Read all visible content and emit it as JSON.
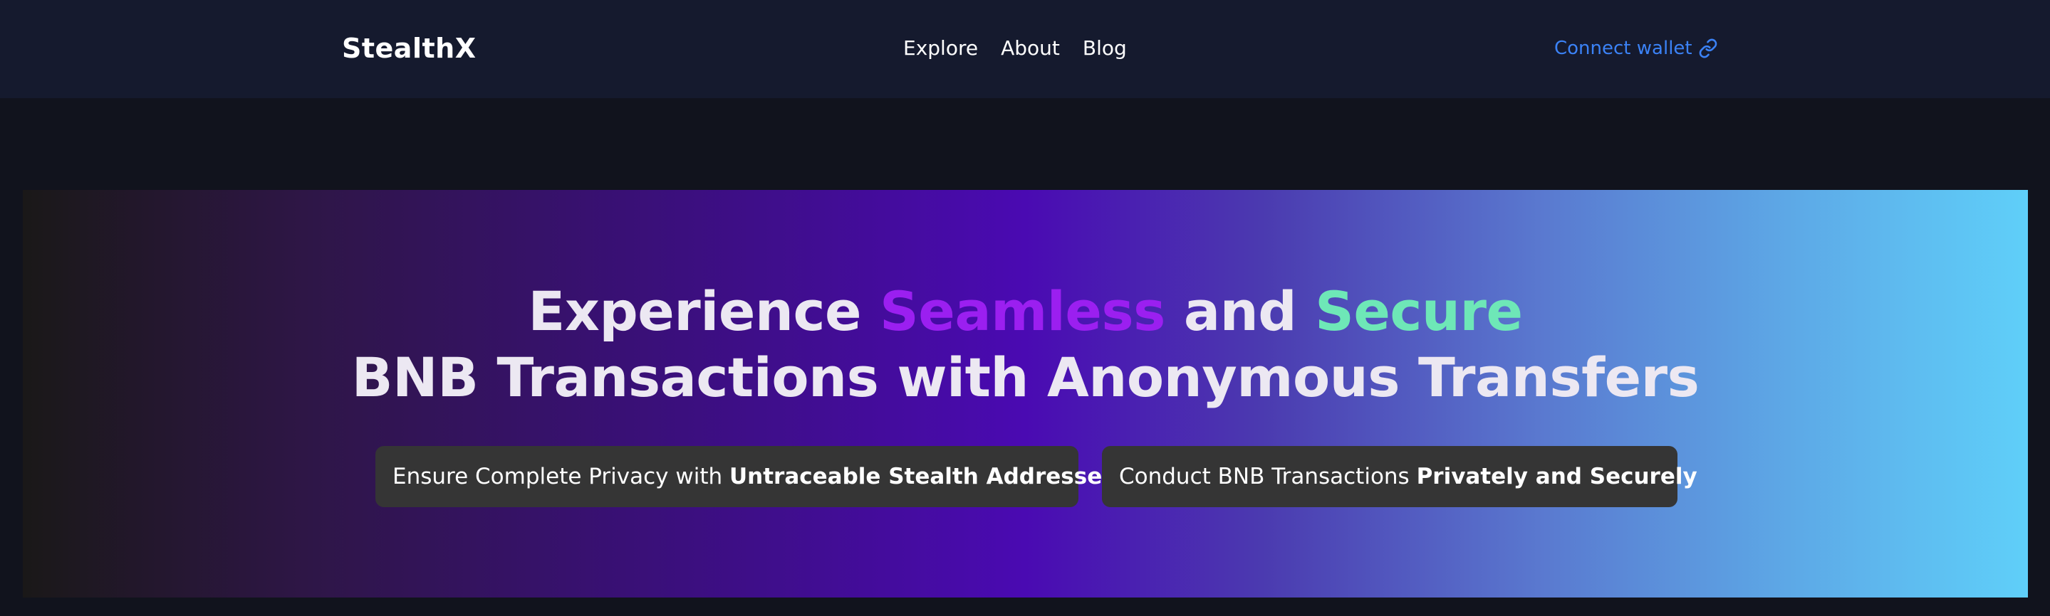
{
  "nav": {
    "logo": "StealthX",
    "links": [
      "Explore",
      "About",
      "Blog"
    ],
    "connect_label": "Connect wallet",
    "connect_icon": "link-icon"
  },
  "hero": {
    "line1": {
      "part1": "Experience ",
      "highlight1": "Seamless",
      "part2": " and ",
      "highlight2": "Secure"
    },
    "line2": "BNB Transactions with Anonymous Transfers",
    "pills": [
      {
        "text": "Ensure Complete Privacy with ",
        "bold": "Untraceable Stealth Addresses"
      },
      {
        "text": "Conduct BNB Transactions ",
        "bold": "Privately and Securely"
      }
    ]
  },
  "colors": {
    "background": "#11131d",
    "navbar": "#151a2e",
    "accent_blue": "#3b82f6",
    "highlight_purple": "#9b1ff0",
    "highlight_green": "#6ee7b7",
    "pill_bg": "#353535"
  }
}
